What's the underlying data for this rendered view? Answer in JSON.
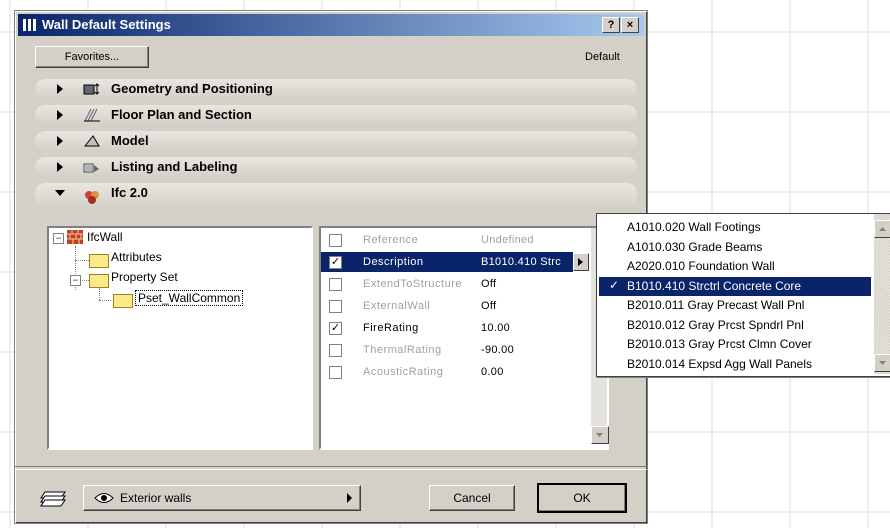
{
  "window": {
    "title": "Wall Default Settings",
    "help_button": "?",
    "close_button": "×"
  },
  "toolbar": {
    "favorites_label": "Favorites...",
    "default_label": "Default"
  },
  "sections": [
    {
      "label": "Geometry and Positioning",
      "icon": "wall-geometry-icon",
      "expanded": false
    },
    {
      "label": "Floor Plan and Section",
      "icon": "floor-plan-icon",
      "expanded": false
    },
    {
      "label": "Model",
      "icon": "model-icon",
      "expanded": false
    },
    {
      "label": "Listing and Labeling",
      "icon": "listing-icon",
      "expanded": false
    },
    {
      "label": "Ifc 2.0",
      "icon": "ifc-icon",
      "expanded": true
    }
  ],
  "tree": {
    "root": "IfcWall",
    "children": [
      "Attributes",
      "Property Set"
    ],
    "grandchild": "Pset_WallCommon"
  },
  "properties": [
    {
      "checked": false,
      "enabled": false,
      "name": "Reference",
      "value": "Undefined"
    },
    {
      "checked": true,
      "enabled": true,
      "name": "Description",
      "value": "B1010.410 Strc",
      "selected": true
    },
    {
      "checked": false,
      "enabled": false,
      "name": "ExtendToStructure",
      "value": "Off"
    },
    {
      "checked": false,
      "enabled": false,
      "name": "ExternalWall",
      "value": "Off"
    },
    {
      "checked": true,
      "enabled": true,
      "name": "FireRating",
      "value": "10.00"
    },
    {
      "checked": false,
      "enabled": false,
      "name": "ThermalRating",
      "value": "-90.00"
    },
    {
      "checked": false,
      "enabled": false,
      "name": "AcousticRating",
      "value": "0.00"
    }
  ],
  "dropdown_options": [
    "A1010.020 Wall Footings",
    "A1010.030 Grade Beams",
    "A2020.010 Foundation Wall",
    "B1010.410 Strctrl Concrete Core",
    "B2010.011 Gray Precast Wall Pnl",
    "B2010.012 Gray Prcst Spndrl Pnl",
    "B2010.013 Gray Prcst Clmn Cover",
    "B2010.014 Expsd Agg Wall Panels"
  ],
  "dropdown_selected_index": 3,
  "footer": {
    "layer_label": "Exterior walls",
    "cancel_label": "Cancel",
    "ok_label": "OK"
  },
  "colors": {
    "title_bar": "#0a246a",
    "selection": "#0a246a",
    "dialog_face": "#d4d0c8"
  }
}
